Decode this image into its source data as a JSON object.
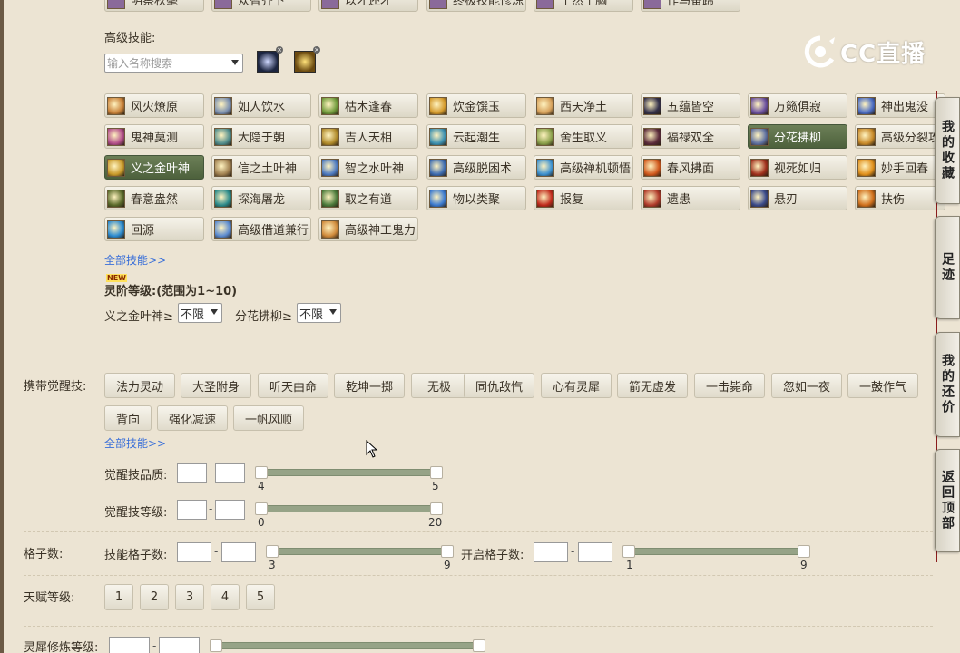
{
  "logo": {
    "text": "CC直播"
  },
  "top_partial": [
    "明察秋毫",
    "众智齐下",
    "以才还才",
    "终极技能修炼",
    "了然于胸",
    "作马奋蹄"
  ],
  "advanced": {
    "label": "高级技能:",
    "search_placeholder": "输入名称搜索",
    "skills": [
      {
        "label": "风火燎原",
        "color": "#c9823a"
      },
      {
        "label": "如人饮水",
        "color": "#7a8fb0"
      },
      {
        "label": "枯木逢春",
        "color": "#6f9a3a"
      },
      {
        "label": "炊金馔玉",
        "color": "#d49a2c"
      },
      {
        "label": "西天净土",
        "color": "#d6a05a"
      },
      {
        "label": "五蕴皆空",
        "color": "#33304a"
      },
      {
        "label": "万籁俱寂",
        "color": "#6a4f9e"
      },
      {
        "label": "神出鬼没",
        "color": "#4a6cc4"
      },
      {
        "label": "鬼神莫测",
        "color": "#b24d8a"
      },
      {
        "label": "大隐于朝",
        "color": "#4f8c8c"
      },
      {
        "label": "吉人天相",
        "color": "#b08a2a"
      },
      {
        "label": "云起潮生",
        "color": "#3a8fb0"
      },
      {
        "label": "舍生取义",
        "color": "#8aa04a"
      },
      {
        "label": "福禄双全",
        "color": "#5a2a3a"
      },
      {
        "label": "分花拂柳",
        "color": "#5d6fa0"
      },
      {
        "label": "高级分裂攻",
        "color": "#c88a2a"
      },
      {
        "label": "义之金叶神",
        "color": "#c99a2a"
      },
      {
        "label": "信之土叶神",
        "color": "#a08050"
      },
      {
        "label": "智之水叶神",
        "color": "#4a78c0"
      },
      {
        "label": "高级脱困术",
        "color": "#3a6ab0"
      },
      {
        "label": "高级禅机顿悟",
        "color": "#3a90d0"
      },
      {
        "label": "春风拂面",
        "color": "#d0581c"
      },
      {
        "label": "视死如归",
        "color": "#a0301c"
      },
      {
        "label": "妙手回春",
        "color": "#e0901c"
      },
      {
        "label": "春意盎然",
        "color": "#5a6a2a"
      },
      {
        "label": "探海屠龙",
        "color": "#2a8a8a"
      },
      {
        "label": "取之有道",
        "color": "#4a7a3a"
      },
      {
        "label": "物以类聚",
        "color": "#3a7ad0"
      },
      {
        "label": "报复",
        "color": "#c02a1c"
      },
      {
        "label": "遗患",
        "color": "#b03a2a"
      },
      {
        "label": "悬刃",
        "color": "#3a4a8a"
      },
      {
        "label": "扶伤",
        "color": "#d0701c"
      },
      {
        "label": "回源",
        "color": "#2a8ad0"
      },
      {
        "label": "高级借道兼行",
        "color": "#5a8ad0"
      },
      {
        "label": "高级神工鬼力",
        "color": "#d08a3a"
      }
    ],
    "selected": [
      "分花拂柳",
      "义之金叶神"
    ],
    "all_link": "全部技能>>"
  },
  "spirit": {
    "new_badge": "NEW",
    "title": "灵阶等级:",
    "range": "(范围为1~10)",
    "rows": [
      {
        "label": "义之金叶神≥",
        "value": "不限"
      },
      {
        "label": "分花拂柳≥",
        "value": "不限"
      }
    ]
  },
  "awaken": {
    "label": "携带觉醒技:",
    "skills": [
      "法力灵动",
      "大圣附身",
      "听天由命",
      "乾坤一掷",
      "无极",
      "同仇敌忾",
      "心有灵犀",
      "箭无虚发",
      "一击毙命",
      "忽如一夜",
      "一鼓作气",
      "背向",
      "强化减速",
      "一帆风顺"
    ],
    "all_link": "全部技能>>",
    "quality": {
      "label": "觉醒技品质:",
      "min": 4,
      "max": 5
    },
    "level": {
      "label": "觉醒技等级:",
      "min": 0,
      "max": 20
    }
  },
  "slots": {
    "label": "格子数:",
    "skill_slots": {
      "label": "技能格子数:",
      "min": 3,
      "max": 9
    },
    "open_slots": {
      "label": "开启格子数:",
      "min": 1,
      "max": 9
    }
  },
  "talent": {
    "label": "天赋等级:",
    "levels": [
      "1",
      "2",
      "3",
      "4",
      "5"
    ]
  },
  "cultivation": {
    "label": "灵犀修炼等级:"
  },
  "sidebar": [
    {
      "label": "我的收藏"
    },
    {
      "label": "足迹"
    },
    {
      "label": "我的还价"
    },
    {
      "label": "返回顶部"
    }
  ],
  "range_separator": "-"
}
